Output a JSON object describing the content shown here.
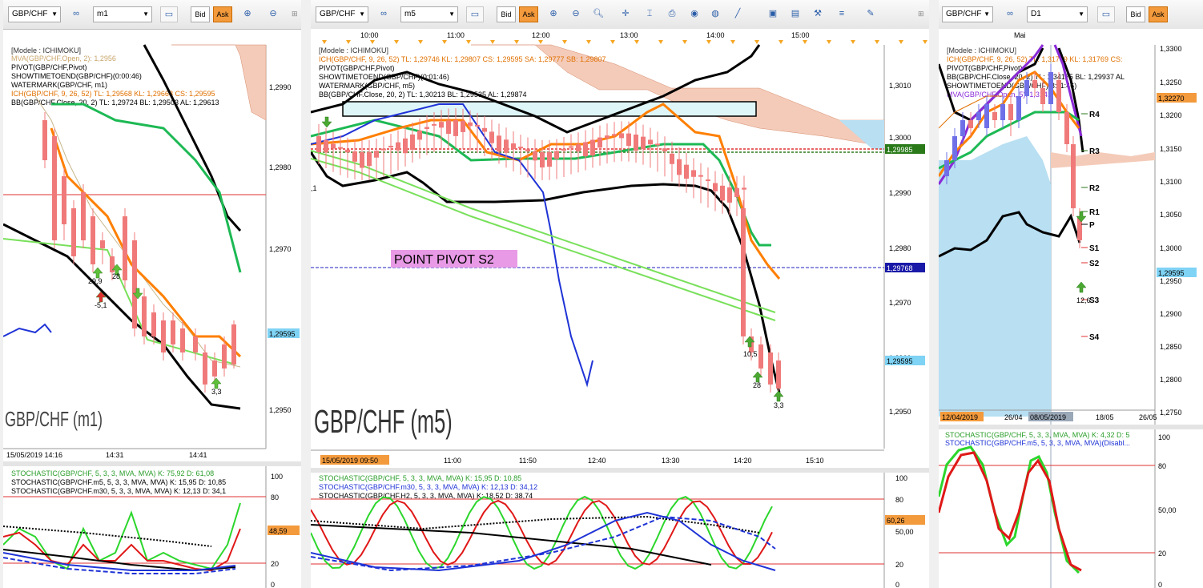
{
  "panels": {
    "m1": {
      "symbol": "GBP/CHF",
      "link_icon": "link-icon",
      "timeframe": "m1",
      "bid": "Bid",
      "ask": "Ask",
      "legend": {
        "model": "[Modele : ICHIMOKU]",
        "mva": "MVA(GBP/CHF.Open, 2): 1,2956",
        "pivot": "PIVOT(GBP/CHF,Pivot)",
        "showtime": "SHOWTIMETOEND(GBP/CHF)(0:00:46)",
        "watermark": "WATERMARK(GBP/CHF, m1)",
        "ich": "ICH(GBP/CHF, 9, 26, 52)  TL: 1,29568  KL: 1,29668  CS: 1,29595",
        "bb": "BB(GBP/CHF.Close, 20, 2)  TL: 1,29724  BL: 1,29503  AL: 1,29613"
      },
      "price_axis": [
        "1,2990",
        "1,2980",
        "1,2970",
        "1,2960",
        "1,2950"
      ],
      "price_marker": "1,29595",
      "time_axis": [
        "15/05/2019 14:16",
        "14:31",
        "14:41"
      ],
      "watermark_text": "GBP/CHF (m1)",
      "annotations": [
        "29,9",
        "28",
        "-5,1",
        "3,3"
      ],
      "stoch_legend": [
        "STOCHASTIC(GBP/CHF, 5, 3, 3, MVA, MVA)  K: 75,92  D: 61,08",
        "STOCHASTIC(GBP/CHF.m5, 5, 3, 3, MVA, MVA)  K: 15,95  D: 10,85",
        "STOCHASTIC(GBP/CHF.m30, 5, 3, 3, MVA, MVA)  K: 12,13  D: 34,1"
      ],
      "stoch_axis": [
        "100",
        "80",
        "20",
        "0"
      ],
      "stoch_marker": "48,59"
    },
    "m5": {
      "symbol": "GBP/CHF",
      "timeframe": "m5",
      "bid": "Bid",
      "ask": "Ask",
      "top_time_axis": [
        "10:00",
        "11:00",
        "12:00",
        "13:00",
        "14:00",
        "15:00"
      ],
      "legend": {
        "model": "[Modele : ICHIMOKU]",
        "ich": "ICH(GBP/CHF, 9, 26, 52)  TL: 1,29746  KL: 1,29807  CS: 1,29595  SA: 1,29777  SB: 1,29807",
        "pivot": "PIVOT(GBP/CHF,Pivot)",
        "showtime": "SHOWTIMETOEND(GBP/CHF)(0:01:46)",
        "watermark": "WATERMARK(GBP/CHF, m5)",
        "bb": "BB(GBP/CHF.Close, 20, 2)  TL: 1,30213  BL: 1,29535  AL: 1,29874"
      },
      "price_axis": [
        "1,3010",
        "1,3000",
        "1,2990",
        "1,2980",
        "1,2970",
        "1,2960",
        "1,2950"
      ],
      "price_marker_top": "1,29985",
      "price_marker_pivot": "1,29768",
      "price_marker_current": "1,29595",
      "pivot_label": "POINT PIVOT S2",
      "watermark_text": "GBP/CHF (m5)",
      "annotations": [
        "10,5",
        "28",
        "3,3",
        ",1"
      ],
      "time_axis": [
        "15/05/2019 09:50",
        "11:00",
        "11:50",
        "12:40",
        "13:30",
        "14:20",
        "15:10"
      ],
      "stoch_legend": [
        "STOCHASTIC(GBP/CHF, 5, 3, 3, MVA, MVA)  K: 15,95  D: 10,85",
        "STOCHASTIC(GBP/CHF.m30, 5, 3, 3, MVA, MVA)  K: 12,13  D: 34,12",
        "STOCHASTIC(GBP/CHF.H2, 5, 3, 3, MVA, MVA)  K: 18,52  D: 38,74"
      ],
      "stoch_axis": [
        "100",
        "80",
        "50,00",
        "20",
        "0"
      ],
      "stoch_marker": "60,26"
    },
    "d1": {
      "symbol": "GBP/CHF",
      "timeframe": "D1",
      "bid": "Bid",
      "ask": "Ask",
      "top_time_axis": [
        "Mai"
      ],
      "legend": {
        "model": "[Modele : ICHIMOKU]",
        "ich": "ICH(GBP/CHF, 9, 26, 52)  TL: 1,31769  KL: 1,31769  CS:",
        "pivot": "PIVOT(GBP/CHF,Pivot)",
        "bb": "BB(GBP/CHF.Close, 20, 2)  TL: 1,34175  BL: 1,29937  AL",
        "showtime": "SHOWTIMETOEND(GBP/CHF)(8:11:46)",
        "mva": "MVA(GBP/CHF.Open, 5): 1,3141"
      },
      "price_axis": [
        "1,3300",
        "1,3250",
        "1,3200",
        "1,3150",
        "1,3100",
        "1,3050",
        "1,3000",
        "1,2950",
        "1,2900",
        "1,2850",
        "1,2800",
        "1,2750"
      ],
      "price_marker_top": "1,32270",
      "price_marker_current": "1,29595",
      "pivot_levels": [
        "R4",
        "R3",
        "R2",
        "R1",
        "P",
        "S1",
        "S2",
        "S3",
        "S4"
      ],
      "annotations": [
        "12,6"
      ],
      "time_axis": [
        "12/04/2019",
        "26/04",
        "08/05/2019",
        "18/05",
        "26/05"
      ],
      "stoch_legend": [
        "STOCHASTIC(GBP/CHF, 5, 3, 3, MVA, MVA)  K: 4,32  D: 5",
        "STOCHASTIC(GBP/CHF.m5, 5, 3, 3, MVA, MVA)(Disabl..."
      ],
      "stoch_axis": [
        "100",
        "80",
        "50,00",
        "20",
        "0"
      ]
    }
  },
  "colors": {
    "ask": "#f39a3c",
    "ich_orange": "#ff7f00",
    "kijun_green": "#1db954",
    "bb_black": "#000000",
    "chikou_blue": "#1f33d6",
    "trend_green": "#78e05a",
    "cloud_fill": "#f4cbb9",
    "cloud_blue": "#b8dff2",
    "candle_up": "#6f70e8",
    "candle_down": "#f07a7a",
    "pivot_label_bg": "#e89ae6",
    "marker_blue": "#7fd3f5"
  }
}
